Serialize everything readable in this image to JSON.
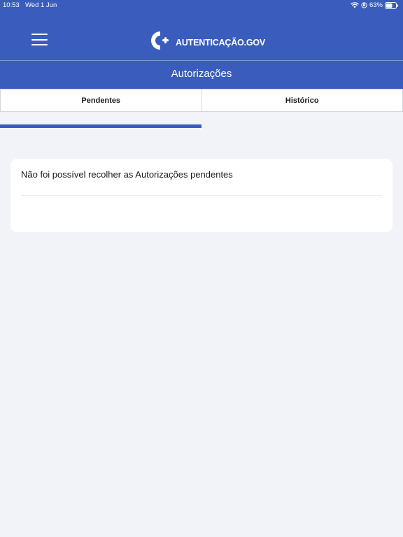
{
  "status_bar": {
    "time": "10:53",
    "date": "Wed 1 Jun",
    "battery_percent": "63%",
    "icons": [
      "wifi-icon",
      "orientation-lock-icon",
      "battery-icon"
    ]
  },
  "header": {
    "menu_icon": "hamburger-menu-icon",
    "logo_text": "AUTENTICAÇÃO.GOV",
    "title": "Autorizações",
    "accent_color": "#3a5dbd"
  },
  "tabs": [
    {
      "label": "Pendentes",
      "selected": true
    },
    {
      "label": "Histórico",
      "selected": false
    }
  ],
  "content": {
    "message": "Não foi possível recolher as Autorizações pendentes"
  }
}
